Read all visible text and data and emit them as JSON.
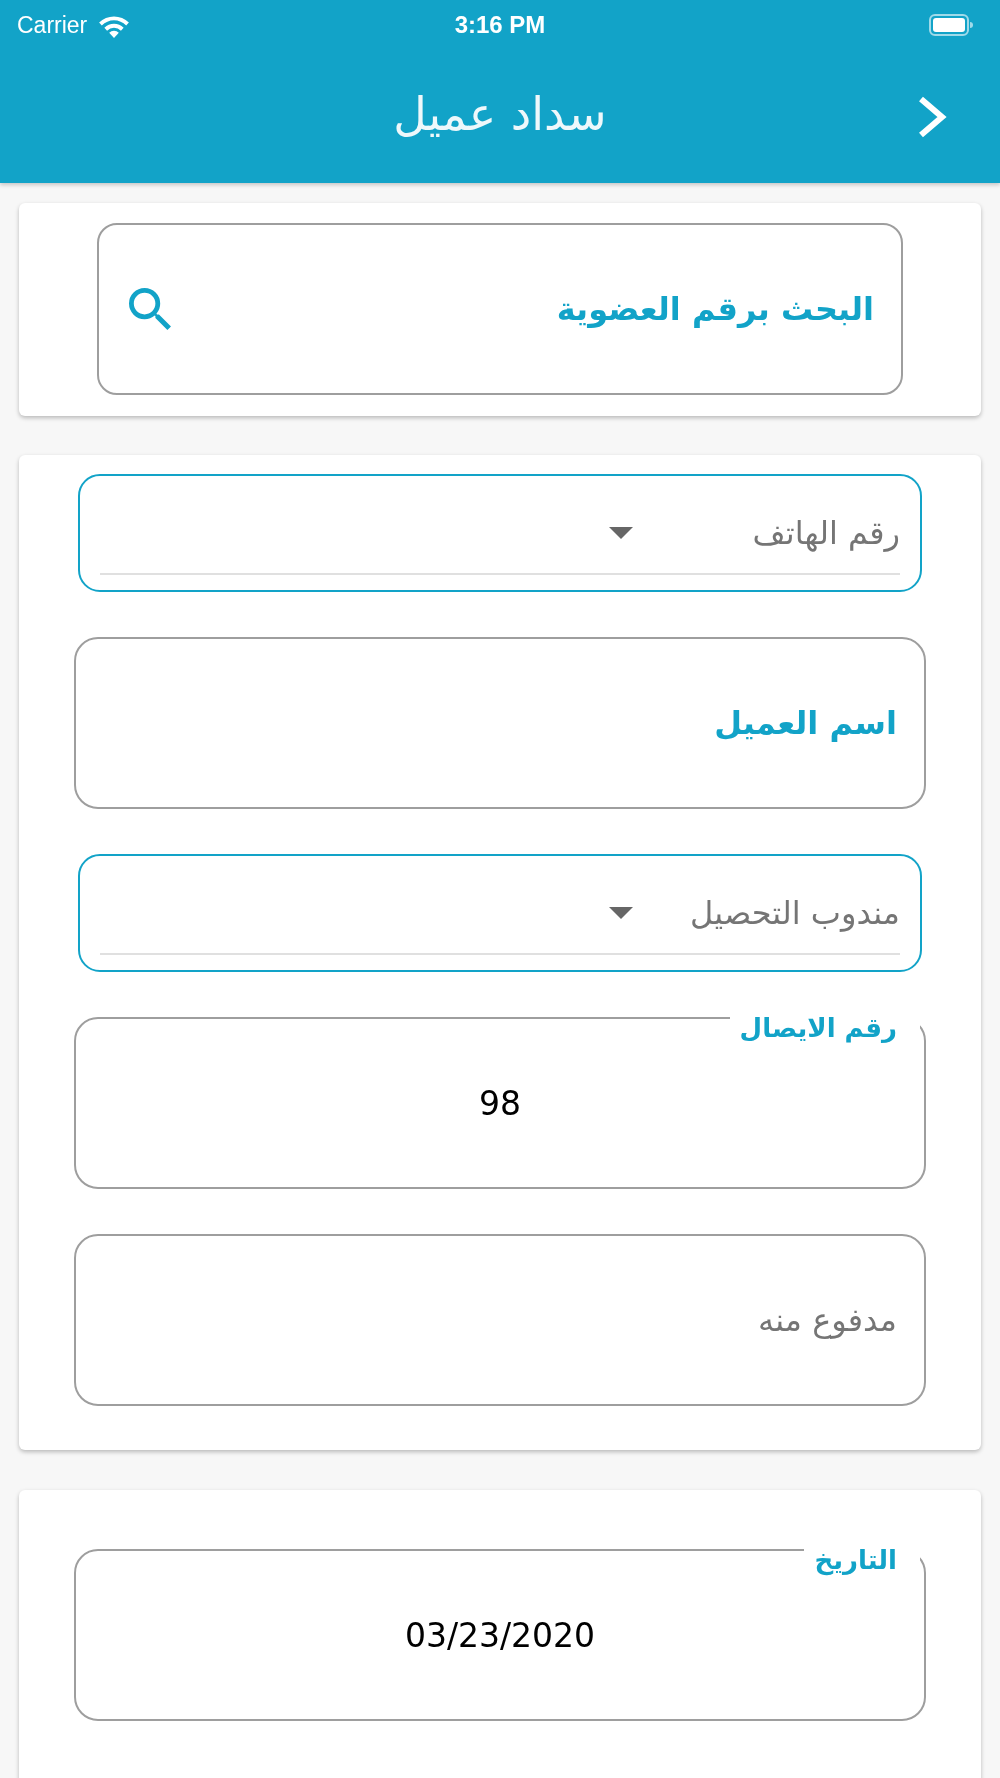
{
  "status_bar": {
    "carrier": "Carrier",
    "time": "3:16 PM"
  },
  "header": {
    "title": "سداد عميل"
  },
  "search_card": {
    "search": {
      "placeholder": "البحث برقم العضوية"
    }
  },
  "customer_card": {
    "fields": [
      {
        "kind": "dropdown",
        "placeholder": "رقم الهاتف"
      },
      {
        "kind": "accent_input",
        "placeholder": "اسم العميل"
      },
      {
        "kind": "dropdown",
        "placeholder": "مندوب التحصيل"
      },
      {
        "kind": "labeled_input",
        "label": "رقم الايصال",
        "value": "98"
      },
      {
        "kind": "input",
        "placeholder": "مدفوع منه"
      }
    ]
  },
  "date_card": {
    "fields": [
      {
        "kind": "labeled_input",
        "label": "التاريخ",
        "value": "03/23/2020"
      }
    ]
  }
}
